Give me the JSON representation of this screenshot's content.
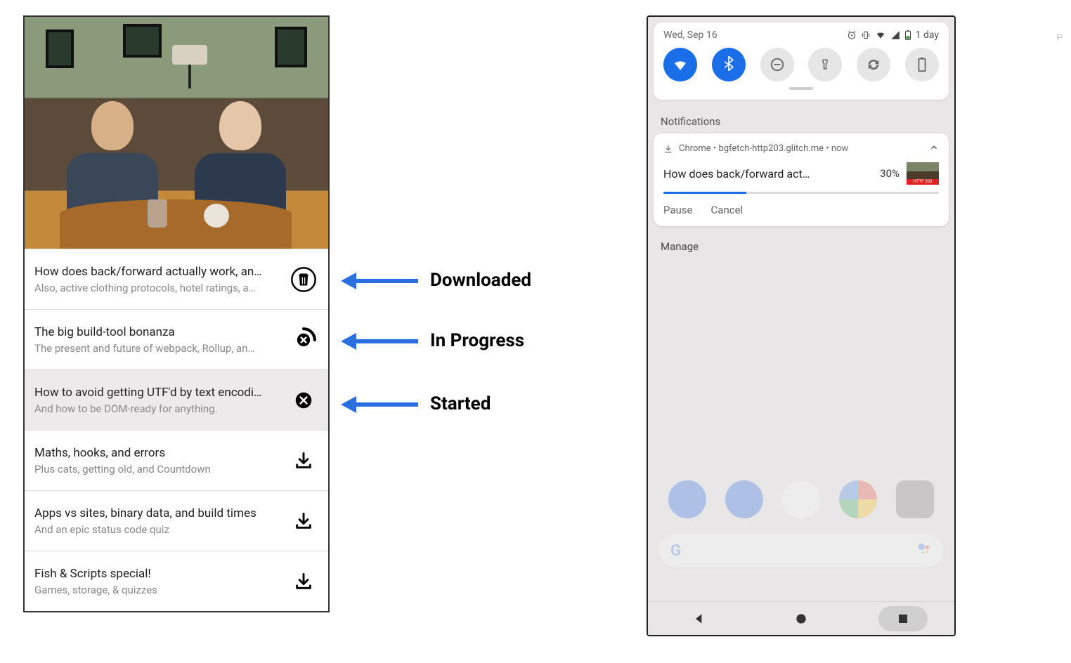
{
  "annotations": {
    "downloaded": "Downloaded",
    "in_progress": "In Progress",
    "started": "Started"
  },
  "episodes": [
    {
      "title": "How does back/forward actually work, an…",
      "subtitle": "Also, active clothing protocols, hotel ratings, a…",
      "status": "downloaded",
      "highlight": false
    },
    {
      "title": "The big build-tool bonanza",
      "subtitle": "The present and future of webpack, Rollup, an…",
      "status": "in_progress",
      "highlight": false
    },
    {
      "title": "How to avoid getting UTF'd by text encodi…",
      "subtitle": "And how to be DOM-ready for anything.",
      "status": "started",
      "highlight": true
    },
    {
      "title": "Maths, hooks, and errors",
      "subtitle": "Plus cats, getting old, and Countdown",
      "status": "download",
      "highlight": false
    },
    {
      "title": "Apps vs sites, binary data, and build times",
      "subtitle": "And an epic status code quiz",
      "status": "download",
      "highlight": false
    },
    {
      "title": "Fish & Scripts special!",
      "subtitle": "Games, storage, & quizzes",
      "status": "download",
      "highlight": false
    }
  ],
  "right": {
    "date": "Wed, Sep 16",
    "battery_text": "1 day",
    "notifications_label": "Notifications",
    "notification": {
      "source": "Chrome  •  bgfetch-http203.glitch.me  •  now",
      "title": "How does back/forward act…",
      "percent": "30%",
      "progress_value": 30,
      "actions": {
        "pause": "Pause",
        "cancel": "Cancel"
      }
    },
    "manage": "Manage"
  }
}
